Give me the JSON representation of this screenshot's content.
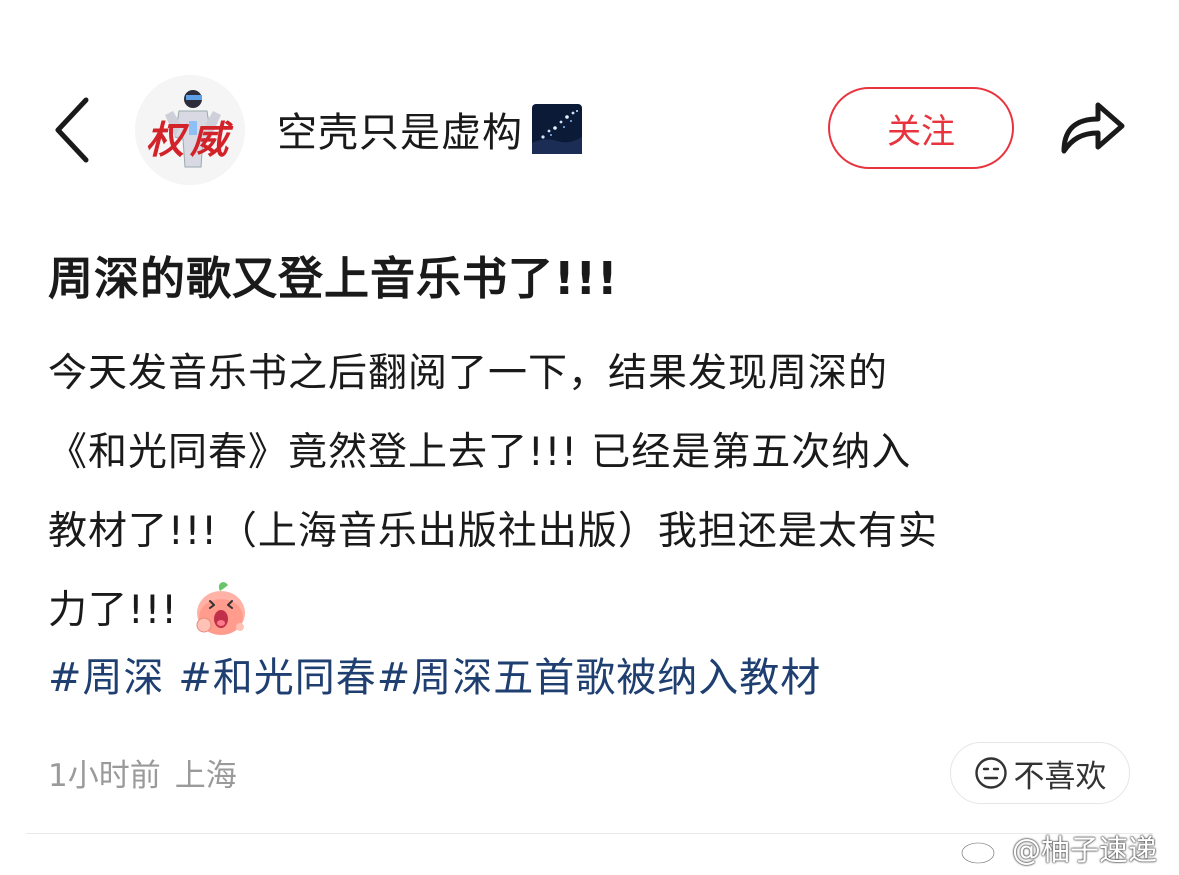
{
  "header": {
    "username": "空壳只是虚构",
    "follow_label": "关注",
    "avatar_text": "权威"
  },
  "post": {
    "title": "周深的歌又登上音乐书了!!!",
    "body_lines": [
      "今天发音乐书之后翻阅了一下，结果发现周深的",
      "《和光同春》竟然登上去了!!! 已经是第五次纳入",
      "教材了!!!（上海音乐出版社出版）我担还是太有实",
      "力了!!!"
    ],
    "hashtags": [
      "#周深",
      "#和光同春#周深五首歌被纳入教材"
    ]
  },
  "meta": {
    "time": "1小时前",
    "location": "上海",
    "dislike_label": "不喜欢"
  },
  "watermark": {
    "text": "@柚子速递"
  },
  "colors": {
    "follow_red": "#e8343f",
    "hashtag_blue": "#1f3f71",
    "meta_gray": "#9a9a9a"
  },
  "icons": {
    "back": "chevron-left-icon",
    "share": "share-arrow-icon",
    "badge": "starry-sky-badge-icon",
    "emoji": "peach-exclaim-emoji-icon",
    "dislike": "frown-face-icon",
    "watermark": "weibo-logo-icon"
  }
}
